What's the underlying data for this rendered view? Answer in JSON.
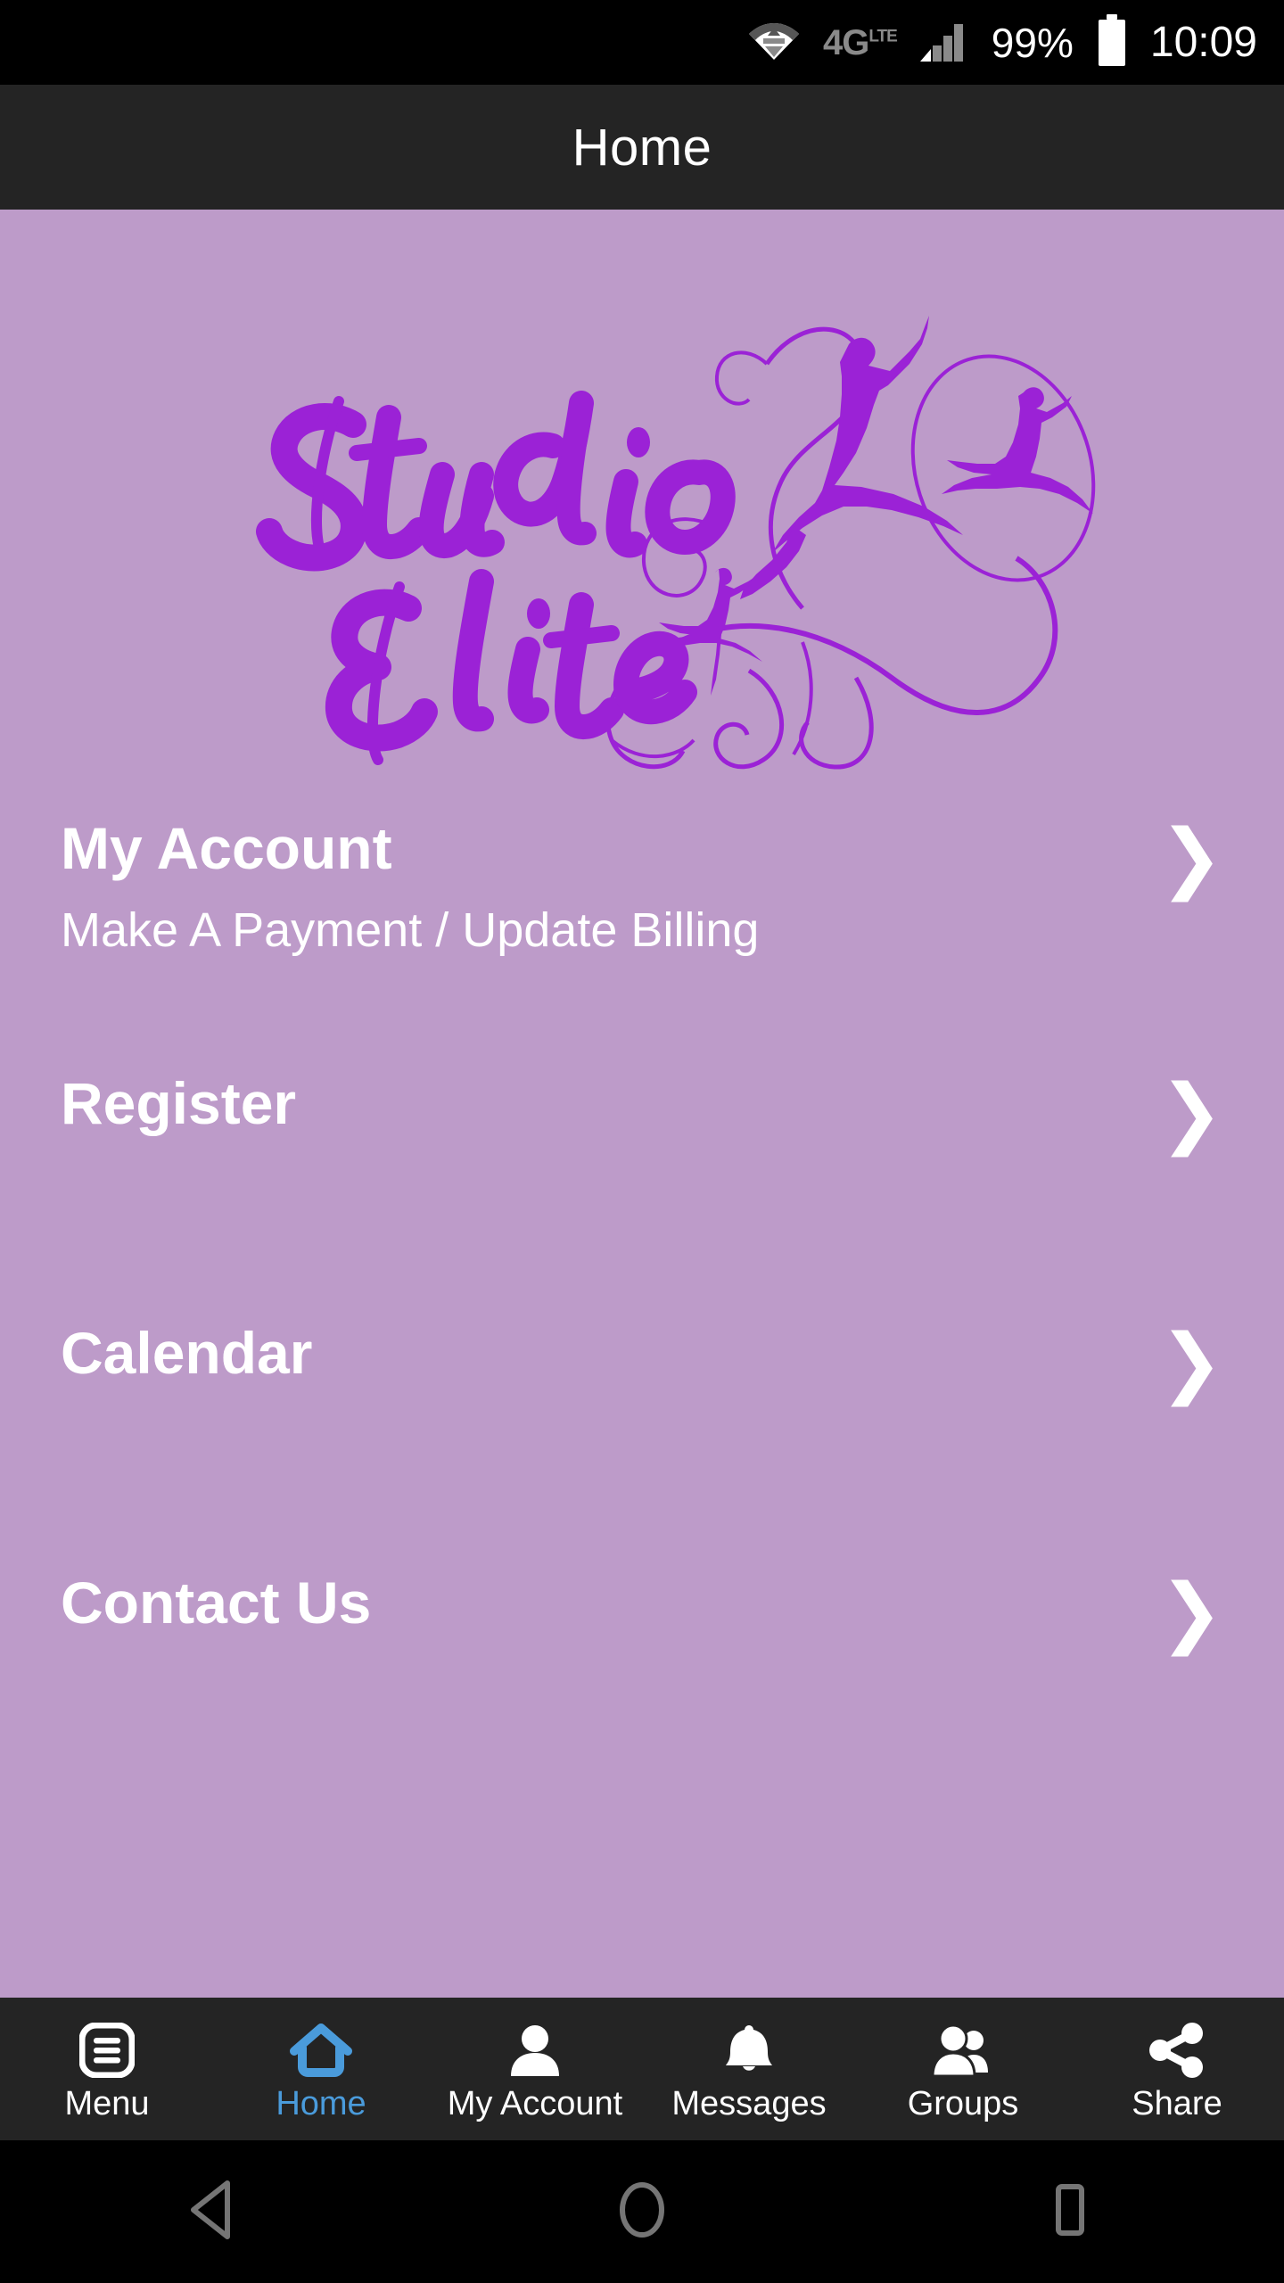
{
  "status_bar": {
    "wifi_icon": "wifi-icon",
    "network_label": "4G",
    "network_superscript": "LTE",
    "signal_icon": "signal-bars-icon",
    "battery_percent": "99%",
    "battery_icon": "battery-full-icon",
    "clock": "10:09"
  },
  "title_bar": {
    "title": "Home"
  },
  "logo": {
    "line1": "Studio",
    "line2": "Elite",
    "alt": "Studio Elite dance studio logo with dancer silhouettes and swirls"
  },
  "menu": {
    "items": [
      {
        "title": "My Account",
        "subtitle": "Make A Payment / Update Billing",
        "chevron": "❯"
      },
      {
        "title": "Register",
        "subtitle": "",
        "chevron": "❯"
      },
      {
        "title": "Calendar",
        "subtitle": "",
        "chevron": "❯"
      },
      {
        "title": "Contact Us",
        "subtitle": "",
        "chevron": "❯"
      }
    ]
  },
  "tab_bar": {
    "tabs": [
      {
        "label": "Menu",
        "icon": "hamburger-menu-icon",
        "active": false
      },
      {
        "label": "Home",
        "icon": "home-icon",
        "active": true
      },
      {
        "label": "My Account",
        "icon": "person-icon",
        "active": false
      },
      {
        "label": "Messages",
        "icon": "bell-icon",
        "active": false
      },
      {
        "label": "Groups",
        "icon": "people-group-icon",
        "active": false
      },
      {
        "label": "Share",
        "icon": "share-nodes-icon",
        "active": false
      }
    ]
  },
  "nav_bar": {
    "back": "back-triangle-icon",
    "home": "home-circle-icon",
    "recents": "recents-square-icon"
  },
  "colors": {
    "background_purple": "#BD9BC9",
    "logo_purple": "#9B22D6",
    "bar_dark": "#242424",
    "active_blue": "#4A9BDB",
    "status_black": "#000000",
    "nav_icon_gray": "#757575"
  }
}
